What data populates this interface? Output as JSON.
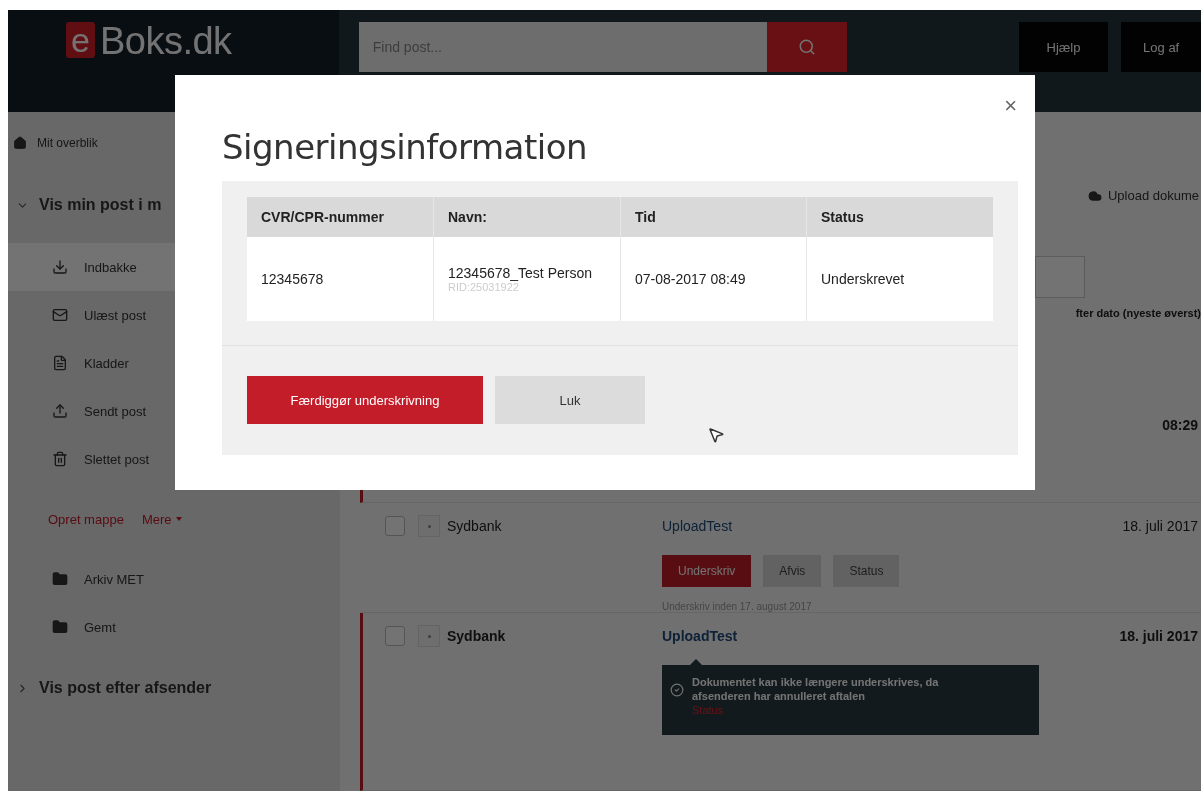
{
  "header": {
    "logo_mark": "e",
    "logo_text": "Boks.dk",
    "search": {
      "placeholder": "Find post..."
    },
    "buttons": [
      "Hjælp",
      "Log af"
    ]
  },
  "sidebar": {
    "overview": "Mit overblik",
    "section": {
      "label": "Vis min post i m",
      "expanded": true
    },
    "items": [
      {
        "label": "Indbakke",
        "selected": true
      },
      {
        "label": "Ulæst post",
        "selected": false
      },
      {
        "label": "Kladder",
        "selected": false
      },
      {
        "label": "Sendt post",
        "selected": false
      },
      {
        "label": "Slettet post",
        "selected": false
      }
    ],
    "links": [
      "Opret mappe",
      "Mere"
    ],
    "folders": [
      "Arkiv MET",
      "Gemt"
    ],
    "section2": {
      "label": "Vis post efter afsender",
      "expanded": false
    }
  },
  "main": {
    "upload": "Upload dokume",
    "sort": "fter dato (nyeste øverst)",
    "messages": [
      {
        "date": "08:29",
        "unread": true
      },
      {
        "sender": "Sydbank",
        "subject": "UploadTest",
        "date": "18. juli 2017",
        "unread": false,
        "actions": [
          {
            "label": "Underskriv",
            "kind": "primary"
          },
          {
            "label": "Afvis",
            "kind": "secondary"
          },
          {
            "label": "Status",
            "kind": "secondary"
          }
        ],
        "note": "Underskriv inden 17. august 2017"
      },
      {
        "sender": "Sydbank",
        "subject": "UploadTest",
        "date": "18. juli 2017",
        "unread": true,
        "tooltip": {
          "text": "Dokumentet kan ikke længere underskrives, da afsenderen har annulleret aftalen",
          "link": "Status"
        }
      }
    ]
  },
  "dialog": {
    "title": "Signeringsinformation",
    "close": "×",
    "columns": [
      "CVR/CPR-nummer",
      "Navn:",
      "Tid",
      "Status"
    ],
    "rows": [
      {
        "cvr": "12345678",
        "name": "12345678_Test Person",
        "rid": "RID:25031922",
        "time": "07-08-2017 08:49",
        "status": "Underskrevet"
      }
    ],
    "buttons": [
      {
        "label": "Færdiggør underskrivning",
        "kind": "primary"
      },
      {
        "label": "Luk",
        "kind": "secondary"
      }
    ]
  }
}
